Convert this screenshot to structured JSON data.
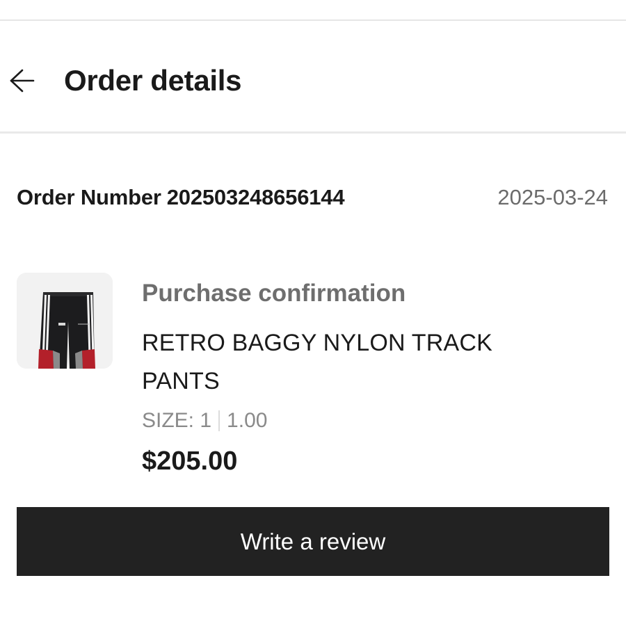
{
  "header": {
    "back_icon": "arrow-left-icon",
    "title": "Order details"
  },
  "order": {
    "number_label": "Order Number",
    "number_value": "202503248656144",
    "date": "2025-03-24"
  },
  "item": {
    "thumbnail_icon": "track-pants-image",
    "status": "Purchase confirmation",
    "name": "RETRO BAGGY NYLON TRACK PANTS",
    "size_label": "SIZE: 1",
    "size_value": "1.00",
    "price": "$205.00"
  },
  "actions": {
    "review_label": "Write a review"
  },
  "colors": {
    "button_bg": "#222222",
    "button_text": "#ffffff",
    "status_text": "#6e6e6e",
    "date_text": "#6b6b6b",
    "size_text": "#8a8a8a"
  }
}
